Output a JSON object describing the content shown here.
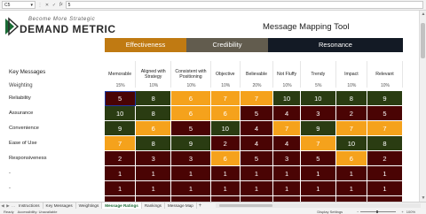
{
  "formula_bar": {
    "cell_ref": "C5",
    "fx": "fx",
    "value": "5"
  },
  "logo": {
    "tagline": "Become More Strategic",
    "name": "DEMAND METRIC"
  },
  "title": "Message Mapping Tool",
  "groups": [
    {
      "label": "Effectiveness",
      "color": "#c07a12"
    },
    {
      "label": "Credibility",
      "color": "#625c4e"
    },
    {
      "label": "Resonance",
      "color": "#131a25"
    }
  ],
  "key_messages_label": "Key Messages",
  "weighting_label": "Weighting",
  "columns": [
    "Memorable",
    "Aligned with Strategy",
    "Consistent with Positioning",
    "Objective",
    "Believable",
    "Not Fluffy",
    "Trendy",
    "Impact",
    "Relevant"
  ],
  "weights": [
    "15%",
    "10%",
    "10%",
    "10%",
    "20%",
    "10%",
    "5%",
    "10%",
    "10%"
  ],
  "rows": [
    {
      "label": "Reliability",
      "values": [
        "5",
        "8",
        "6",
        "7",
        "7",
        "10",
        "10",
        "8",
        "9"
      ]
    },
    {
      "label": "Assurance",
      "values": [
        "10",
        "8",
        "6",
        "6",
        "5",
        "4",
        "3",
        "2",
        "5"
      ]
    },
    {
      "label": "Convenience",
      "values": [
        "9",
        "6",
        "5",
        "10",
        "4",
        "7",
        "9",
        "7",
        "7"
      ]
    },
    {
      "label": "Ease of Use",
      "values": [
        "7",
        "8",
        "9",
        "2",
        "4",
        "4",
        "7",
        "10",
        "8"
      ]
    },
    {
      "label": "Responsiveness",
      "values": [
        "2",
        "3",
        "3",
        "6",
        "5",
        "3",
        "5",
        "6",
        "2"
      ]
    },
    {
      "label": "-",
      "values": [
        "1",
        "1",
        "1",
        "1",
        "1",
        "1",
        "1",
        "1",
        "1"
      ]
    },
    {
      "label": "-",
      "values": [
        "1",
        "1",
        "1",
        "1",
        "1",
        "1",
        "1",
        "1",
        "1"
      ]
    },
    {
      "label": "-",
      "values": [
        "1",
        "1",
        "1",
        "1",
        "1",
        "1",
        "1",
        "1",
        "1"
      ]
    }
  ],
  "color_scale": {
    "high": "#2a3c12",
    "mid": "#f5a21c",
    "low": "#4a0404"
  },
  "tabs": [
    "Instructions",
    "Key Messages",
    "Weightings",
    "Message Ratings",
    "Rankings",
    "Message Map"
  ],
  "active_tab": "Message Ratings",
  "status": {
    "ready": "Ready",
    "accessibility": "Accessibility: Unavailable",
    "display": "Display Settings",
    "zoom": "100%"
  }
}
